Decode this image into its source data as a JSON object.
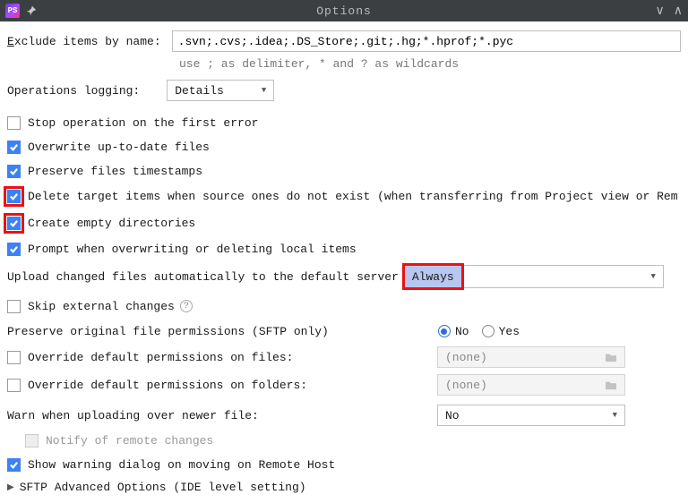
{
  "titlebar": {
    "title": "Options",
    "app_abbrev": "PS"
  },
  "exclude": {
    "label": "Exclude items by name:",
    "value": ".svn;.cvs;.idea;.DS_Store;.git;.hg;*.hprof;*.pyc",
    "hint": "use ; as delimiter, * and ? as wildcards"
  },
  "logging": {
    "label": "Operations logging:",
    "value": "Details"
  },
  "checks": {
    "stop_first_error": "Stop operation on the first error",
    "overwrite_uptodate": "Overwrite up-to-date files",
    "preserve_timestamps": "Preserve files timestamps",
    "delete_target": "Delete target items when source ones do not exist (when transferring from Project view or Rem",
    "create_empty": "Create empty directories",
    "prompt_overwrite": "Prompt when overwriting or deleting local items",
    "skip_external": "Skip external changes",
    "override_files": "Override default permissions on files:",
    "override_folders": "Override default permissions on folders:",
    "notify_remote": "Notify of remote changes",
    "show_warning_move": "Show warning dialog on moving on Remote Host"
  },
  "auto_upload": {
    "label": "Upload changed files automatically to the default server",
    "value": "Always"
  },
  "preserve_perm": {
    "label": "Preserve original file permissions (SFTP only)",
    "options": {
      "no": "No",
      "yes": "Yes"
    },
    "selected": "no"
  },
  "perm_none": "(none)",
  "warn_newer": {
    "label": "Warn when uploading over newer file:",
    "value": "No"
  },
  "sftp_advanced": "SFTP Advanced Options (IDE level setting)"
}
